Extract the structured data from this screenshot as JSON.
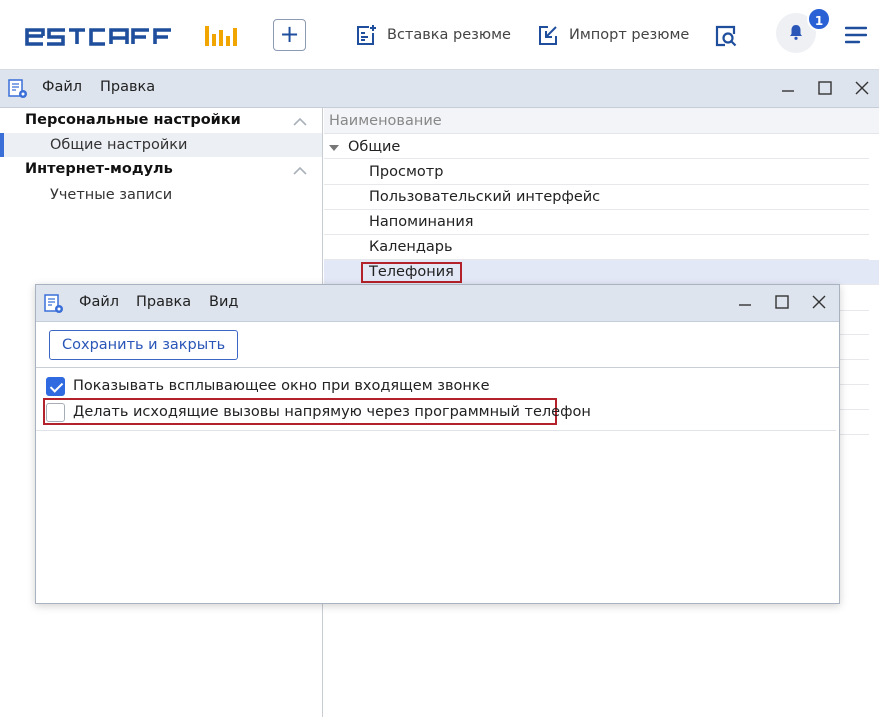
{
  "app": {
    "logo_text": "ESTAFF",
    "add_button": "+",
    "actions": [
      {
        "label": "Вставка резюме",
        "icon": "paste-resume-icon"
      },
      {
        "label": "Импорт резюме",
        "icon": "import-resume-icon"
      }
    ],
    "notifications_count": "1",
    "colors": {
      "brand": "#1f4e9c",
      "accent": "#f0a500",
      "badge": "#2a62d6"
    }
  },
  "settings_window": {
    "menu": [
      "Файл",
      "Правка"
    ],
    "tree": {
      "groups": [
        {
          "label": "Персональные настройки",
          "items": [
            "Общие настройки"
          ]
        },
        {
          "label": "Интернет-модуль",
          "items": [
            "Учетные записи"
          ]
        }
      ]
    },
    "list": {
      "column_header": "Наименование",
      "group_label": "Общие",
      "rows": [
        "Просмотр",
        "Пользовательский интерфейс",
        "Напоминания",
        "Календарь",
        "Телефония"
      ]
    }
  },
  "dialog": {
    "menu": [
      "Файл",
      "Правка",
      "Вид"
    ],
    "save_button": "Сохранить и закрыть",
    "options": [
      {
        "label": "Показывать всплывающее окно при входящем звонке",
        "checked": true
      },
      {
        "label": "Делать исходящие вызовы напрямую через программный телефон",
        "checked": false
      }
    ]
  }
}
